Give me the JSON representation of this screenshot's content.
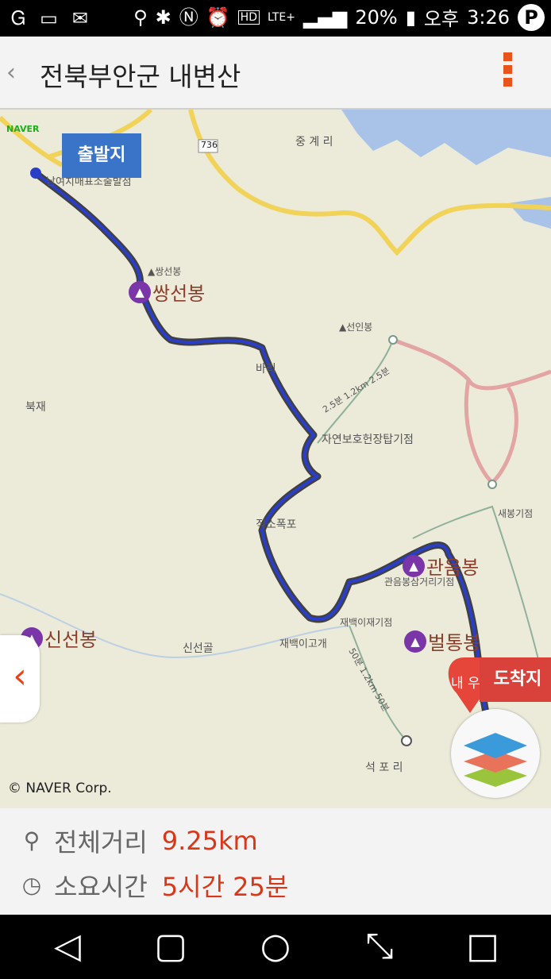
{
  "status_bar": {
    "battery": "20%",
    "time_prefix": "오후",
    "time": "3:26",
    "network": "LTE+",
    "hd": "HD",
    "p_badge": "P"
  },
  "app_bar": {
    "back_glyph": "‹",
    "title": "전북부안군 내변산"
  },
  "map": {
    "naver_logo": "NAVER",
    "copyright": "© NAVER Corp.",
    "start_label": "출발지",
    "end_label": "도착지",
    "start_place": "남여치매표소출발점",
    "road_number": "736",
    "peaks": [
      "쌍선봉",
      "관음봉",
      "벌통봉",
      "신선봉"
    ],
    "places": [
      "중 계 리",
      "▲쌍선봉",
      "▲선인봉",
      "북재",
      "바리",
      "자연보호헌장탑기점",
      "직소폭포",
      "새봉기점",
      "관음봉삼거리기점",
      "재백이재기점",
      "재백이고개",
      "신선골",
      "석 포 리",
      "내 우"
    ],
    "trail_labels": [
      "2.5분 1.2km 2.5분",
      "50분 1.2km 50분"
    ]
  },
  "summary": {
    "distance_label": "전체거리",
    "distance_value": "9.25km",
    "time_label": "소요시간",
    "time_value": "5시간 25분"
  },
  "nav_bar": {
    "back": "◁",
    "recent": "▢",
    "home": "○",
    "collapse": "⤡",
    "square": "□"
  }
}
